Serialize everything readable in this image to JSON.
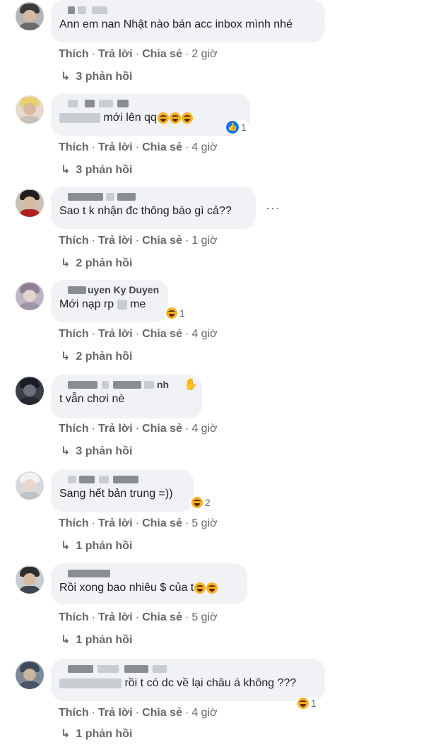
{
  "actions": {
    "like": "Thích",
    "reply": "Trả lời",
    "share": "Chia sẻ",
    "sep": "·"
  },
  "comments": [
    {
      "name": "",
      "text": "Ann em nan Nhật nào bán acc inbox mình nhé",
      "time": "2 giờ",
      "replies": "3 phản hồi"
    },
    {
      "name": "",
      "text": "mới lên qq",
      "time": "4 giờ",
      "replies": "3 phản hồi",
      "reaction_count": "1",
      "reaction_icon": "like-icon"
    },
    {
      "name": "",
      "text": "Sao t k nhận đc thông báo gì cả??",
      "time": "1 giờ",
      "replies": "2 phản hồi"
    },
    {
      "name": "uyen Ky Duyen",
      "text_prefix": "Mới nạp rp",
      "text_suffix": "me",
      "time": "4 giờ",
      "replies": "2 phản hồi",
      "reaction_count": "1",
      "reaction_icon": "haha-icon"
    },
    {
      "name": "nh",
      "text": "t vẫn chơi nè",
      "time": "4 giờ",
      "replies": "3 phản hồi"
    },
    {
      "name": "",
      "text": "Sang hết bản trung =))",
      "time": "5 giờ",
      "replies": "1 phản hồi",
      "reaction_count": "2",
      "reaction_icon": "haha-icon"
    },
    {
      "name": "",
      "text": "Rồi xong bao nhiêu $ của t",
      "time": "5 giờ",
      "replies": "1 phản hồi"
    },
    {
      "name": "",
      "text": "rồi t có dc về lại châu á không ???",
      "time": "4 giờ",
      "replies": "1 phản hồi",
      "reaction_count": "1",
      "reaction_icon": "haha-icon"
    }
  ],
  "icons": {
    "more": "more-options-icon",
    "reply_arrow": "reply-arrow-icon"
  },
  "colors": {
    "bubble": "#f0f2f5",
    "meta": "#65676b",
    "like_blue": "#1877f2",
    "emoji_yellow": "#f7b125"
  }
}
